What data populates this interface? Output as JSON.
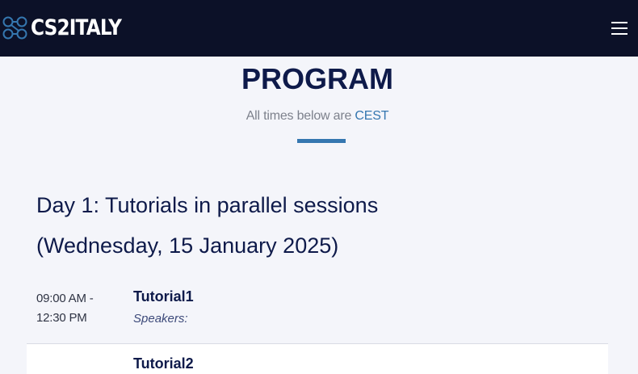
{
  "header": {
    "logo_text": "CS2ITALY",
    "menu_icon": "hamburger-menu-icon",
    "colors": {
      "background": "#0c1128",
      "logo_mark": "#3577b0",
      "text": "#ffffff"
    }
  },
  "program": {
    "title": "PROGRAM",
    "subtitle_prefix": "All times below are",
    "timezone": "CEST",
    "accent_color": "#3577b0"
  },
  "day": {
    "heading": "Day 1: Tutorials in parallel sessions",
    "date": "(Wednesday, 15 January 2025)"
  },
  "sessions": [
    {
      "time_start": "09:00 AM -",
      "time_end": "12:30 PM",
      "name": "Tutorial1",
      "speakers_label": "Speakers:"
    },
    {
      "time_start": "",
      "time_end": "",
      "name": "Tutorial2",
      "speakers_label": ""
    }
  ]
}
